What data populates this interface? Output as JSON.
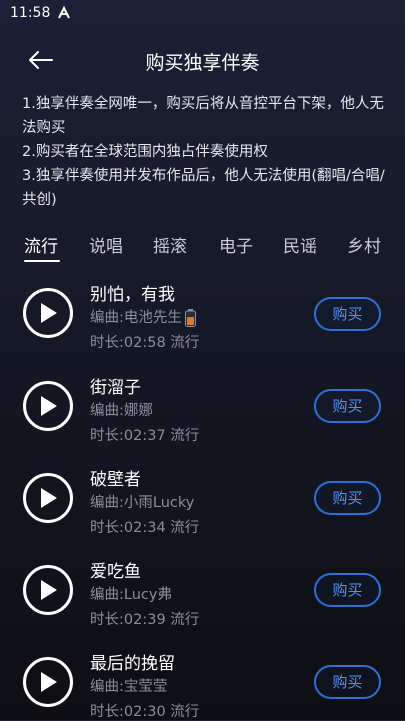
{
  "status_bar": {
    "time": "11:58"
  },
  "header": {
    "title": "购买独享伴奏"
  },
  "notes": [
    "1.独享伴奏全网唯一，购买后将从音控平台下架，他人无法购买",
    "2.购买者在全球范围内独占伴奏使用权",
    "3.独享伴奏使用并发布作品后，他人无法使用(翻唱/合唱/共创)"
  ],
  "tabs": [
    "流行",
    "说唱",
    "摇滚",
    "电子",
    "民谣",
    "乡村"
  ],
  "active_tab": "流行",
  "songs": [
    {
      "title": "别怕，有我",
      "composer": "编曲:电池先生",
      "meta": "时长:02:58 流行",
      "buy_label": "购买"
    },
    {
      "title": "街溜子",
      "composer": "编曲:娜娜",
      "meta": "时长:02:37 流行",
      "buy_label": "购买"
    },
    {
      "title": "破壁者",
      "composer": "编曲:小雨Lucky",
      "meta": "时长:02:34 流行",
      "buy_label": "购买"
    },
    {
      "title": "爱吃鱼",
      "composer": "编曲:Lucy弗",
      "meta": "时长:02:39 流行",
      "buy_label": "购买"
    },
    {
      "title": "最后的挽留",
      "composer": "编曲:宝莹莹",
      "meta": "时长:02:30 流行",
      "buy_label": "购买"
    }
  ],
  "colors": {
    "accent": "#2f6fd6",
    "accent_text": "#5a93f0",
    "secondary_text": "#8b8e9a"
  }
}
